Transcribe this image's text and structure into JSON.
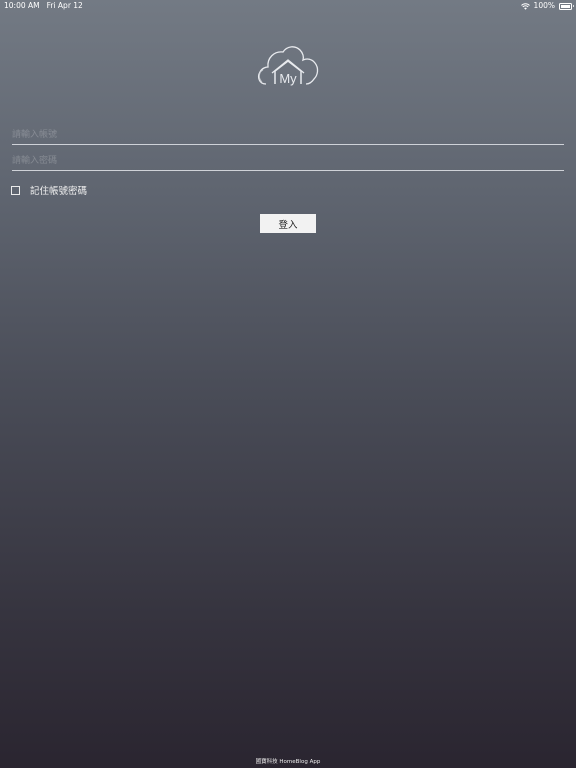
{
  "status_bar": {
    "time": "10:00 AM",
    "date": "Fri Apr 12",
    "battery": "100%",
    "battery_level": 1.0,
    "wifi_icon": "wifi-icon",
    "battery_icon": "battery-icon"
  },
  "logo": {
    "text": "My",
    "icon": "cloud-house-logo"
  },
  "form": {
    "account_placeholder": "請輸入帳號",
    "account_value": "",
    "password_placeholder": "請輸入密碼",
    "password_value": "",
    "remember_label": "記住帳號密碼",
    "remember_checked": false,
    "login_label": "登入"
  },
  "footer": {
    "text": "國寶科技 HomeBlog App"
  },
  "colors": {
    "gradient_top": "#737a84",
    "gradient_bottom": "#2a2530",
    "button_bg": "#f2f2f2",
    "field_line": "#cfd2d8"
  }
}
